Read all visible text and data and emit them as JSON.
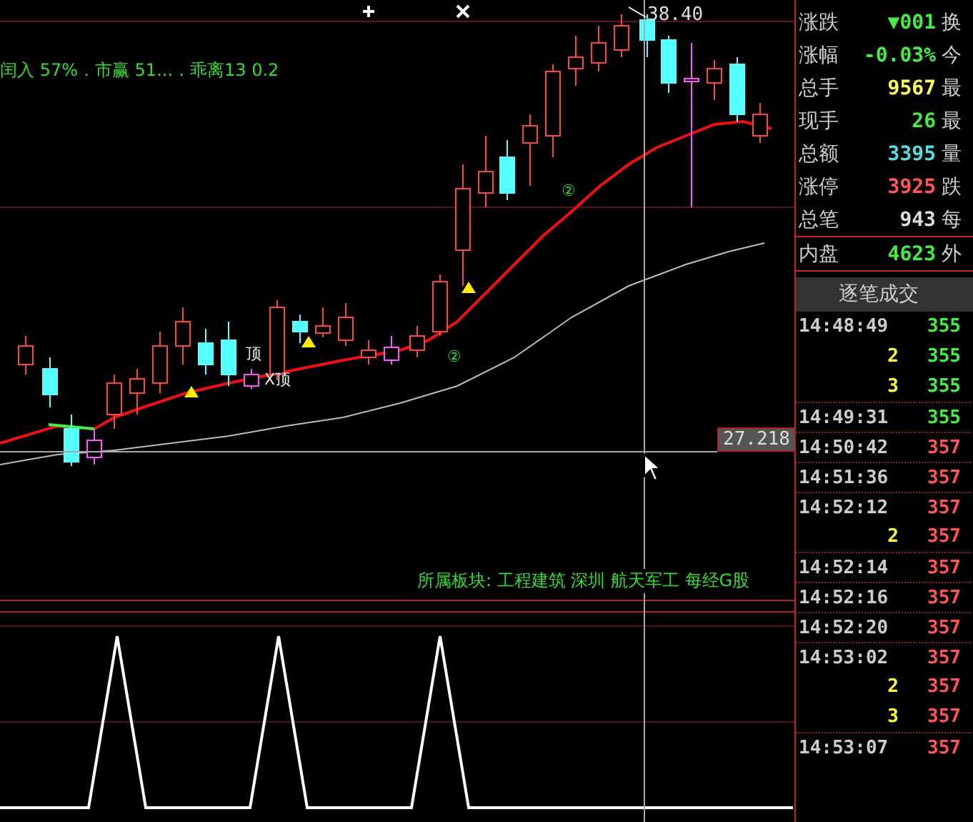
{
  "chart": {
    "indicator_text": "闰入 57%．市赢 51...．乖离13 0.2",
    "high_label": "38.40",
    "crosshair_value": "27.218",
    "sector_text": "所属板块: 工程建筑 深圳 航天军工 每经G股",
    "marks": [
      "②",
      "②",
      "顶",
      "X顶"
    ]
  },
  "quote": [
    {
      "label": "涨跌",
      "value": "▼001",
      "side": "换",
      "color": "#44ee44"
    },
    {
      "label": "涨幅",
      "value": "-0.03%",
      "side": "今",
      "color": "#44ee44"
    },
    {
      "label": "总手",
      "value": "9567",
      "side": "最",
      "color": "#ffff55"
    },
    {
      "label": "现手",
      "value": "26",
      "side": "最",
      "color": "#44ee44"
    },
    {
      "label": "总额",
      "value": "3395",
      "side": "量",
      "color": "#55dddd"
    },
    {
      "label": "涨停",
      "value": "3925",
      "side": "跌",
      "color": "#ff5555"
    },
    {
      "label": "总笔",
      "value": "943",
      "side": "每",
      "color": "#dddddd"
    },
    {
      "label": "内盘",
      "value": "4623",
      "side": "外",
      "color": "#44ee44"
    }
  ],
  "ticks_header": "逐笔成交",
  "ticks": [
    {
      "kind": "time",
      "time": "14:48:49",
      "price": "355",
      "color": "#44ee44"
    },
    {
      "kind": "seq",
      "time": "2",
      "price": "355",
      "color": "#44ee44"
    },
    {
      "kind": "seq",
      "time": "3",
      "price": "355",
      "color": "#44ee44"
    },
    {
      "kind": "time",
      "time": "14:49:31",
      "price": "355",
      "color": "#44ee44"
    },
    {
      "kind": "time",
      "time": "14:50:42",
      "price": "357",
      "color": "#ff5555"
    },
    {
      "kind": "time",
      "time": "14:51:36",
      "price": "357",
      "color": "#ff5555"
    },
    {
      "kind": "time",
      "time": "14:52:12",
      "price": "357",
      "color": "#ff5555"
    },
    {
      "kind": "seq",
      "time": "2",
      "price": "357",
      "color": "#ff5555"
    },
    {
      "kind": "time",
      "time": "14:52:14",
      "price": "357",
      "color": "#ff5555"
    },
    {
      "kind": "time",
      "time": "14:52:16",
      "price": "357",
      "color": "#ff5555"
    },
    {
      "kind": "time",
      "time": "14:52:20",
      "price": "357",
      "color": "#ff5555"
    },
    {
      "kind": "time",
      "time": "14:53:02",
      "price": "357",
      "color": "#ff5555"
    },
    {
      "kind": "seq",
      "time": "2",
      "price": "357",
      "color": "#ff5555"
    },
    {
      "kind": "seq",
      "time": "3",
      "price": "357",
      "color": "#ff5555"
    },
    {
      "kind": "time",
      "time": "14:53:07",
      "price": "357",
      "color": "#ff5555"
    }
  ]
}
